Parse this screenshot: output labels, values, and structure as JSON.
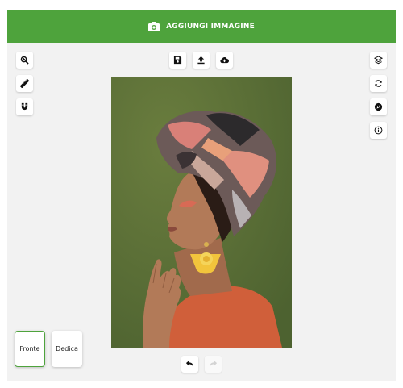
{
  "header": {
    "title": "AGGIUNGI IMMAGINE",
    "icon": "camera-icon"
  },
  "colors": {
    "accent": "#4ea33c",
    "panel": "#f2f2f2"
  },
  "left_tools": [
    {
      "name": "zoom-in-icon"
    },
    {
      "name": "ruler-icon"
    },
    {
      "name": "magnet-icon"
    }
  ],
  "top_tools": [
    {
      "name": "save-icon"
    },
    {
      "name": "upload-icon"
    },
    {
      "name": "cloud-upload-icon"
    }
  ],
  "right_tools": [
    {
      "name": "layers-icon"
    },
    {
      "name": "refresh-icon"
    },
    {
      "name": "compass-icon"
    },
    {
      "name": "info-icon"
    }
  ],
  "bottom_tools": [
    {
      "name": "undo-icon",
      "enabled": true
    },
    {
      "name": "redo-icon",
      "enabled": false
    }
  ],
  "pages": [
    {
      "label": "Fronte",
      "active": true
    },
    {
      "label": "Dedica",
      "active": false
    }
  ]
}
